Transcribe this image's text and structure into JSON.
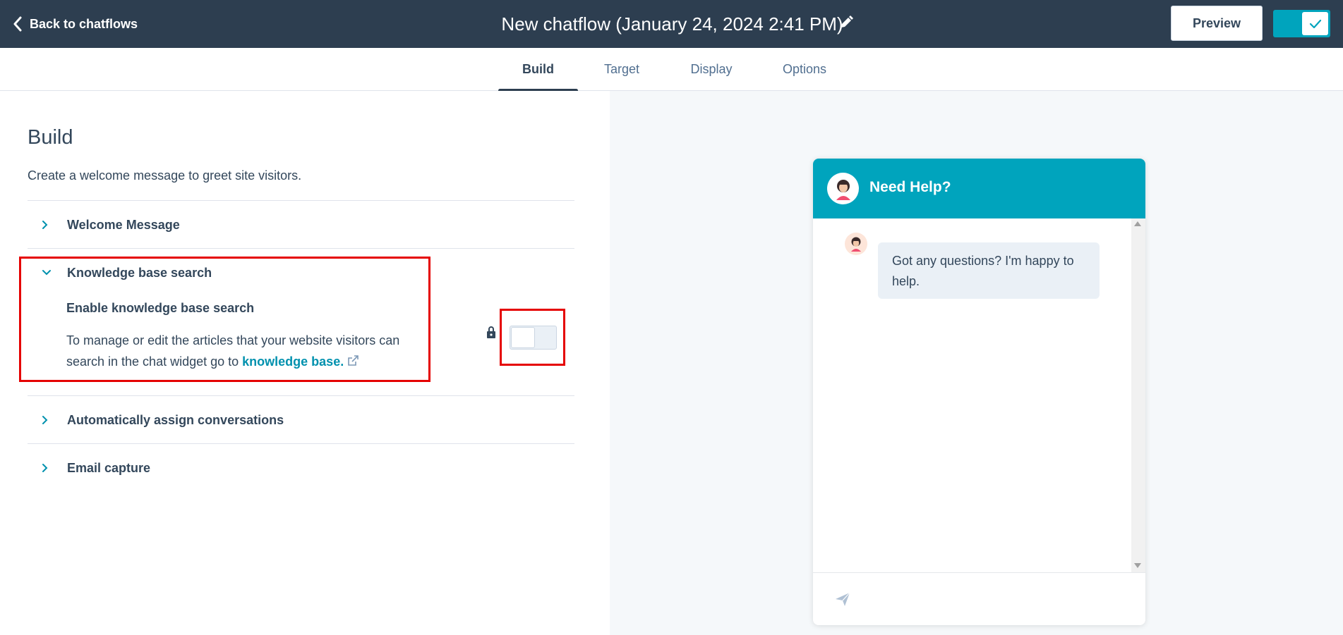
{
  "topbar": {
    "back_label": "Back to chatflows",
    "title": "New chatflow (January 24, 2024 2:41 PM)",
    "preview_label": "Preview",
    "publish_enabled": true,
    "icons": {
      "back": "chevron-left-icon",
      "edit": "pencil-icon",
      "publish": "checkmark-icon"
    }
  },
  "tabs": [
    {
      "label": "Build",
      "active": true
    },
    {
      "label": "Target",
      "active": false
    },
    {
      "label": "Display",
      "active": false
    },
    {
      "label": "Options",
      "active": false
    }
  ],
  "build": {
    "heading": "Build",
    "description": "Create a welcome message to greet site visitors.",
    "sections": [
      {
        "label": "Welcome Message",
        "expanded": false
      },
      {
        "label": "Knowledge base search",
        "expanded": true
      },
      {
        "label": "Automatically assign conversations",
        "expanded": false
      },
      {
        "label": "Email capture",
        "expanded": false
      }
    ],
    "knowledge_base": {
      "title": "Enable knowledge base search",
      "desc_text": "To manage or edit the articles that your website visitors can search in the chat widget go to ",
      "link_label": "knowledge base.",
      "toggle_on": false,
      "locked": true
    }
  },
  "preview": {
    "widget_title": "Need Help?",
    "message": "Got any questions? I'm happy to help.",
    "colors": {
      "header": "#00a4bd",
      "bubble": "#eaf0f6"
    }
  },
  "colors": {
    "topbar": "#2d3e50",
    "accent": "#00a4bd",
    "link": "#0091ae",
    "highlight": "#e50000"
  }
}
